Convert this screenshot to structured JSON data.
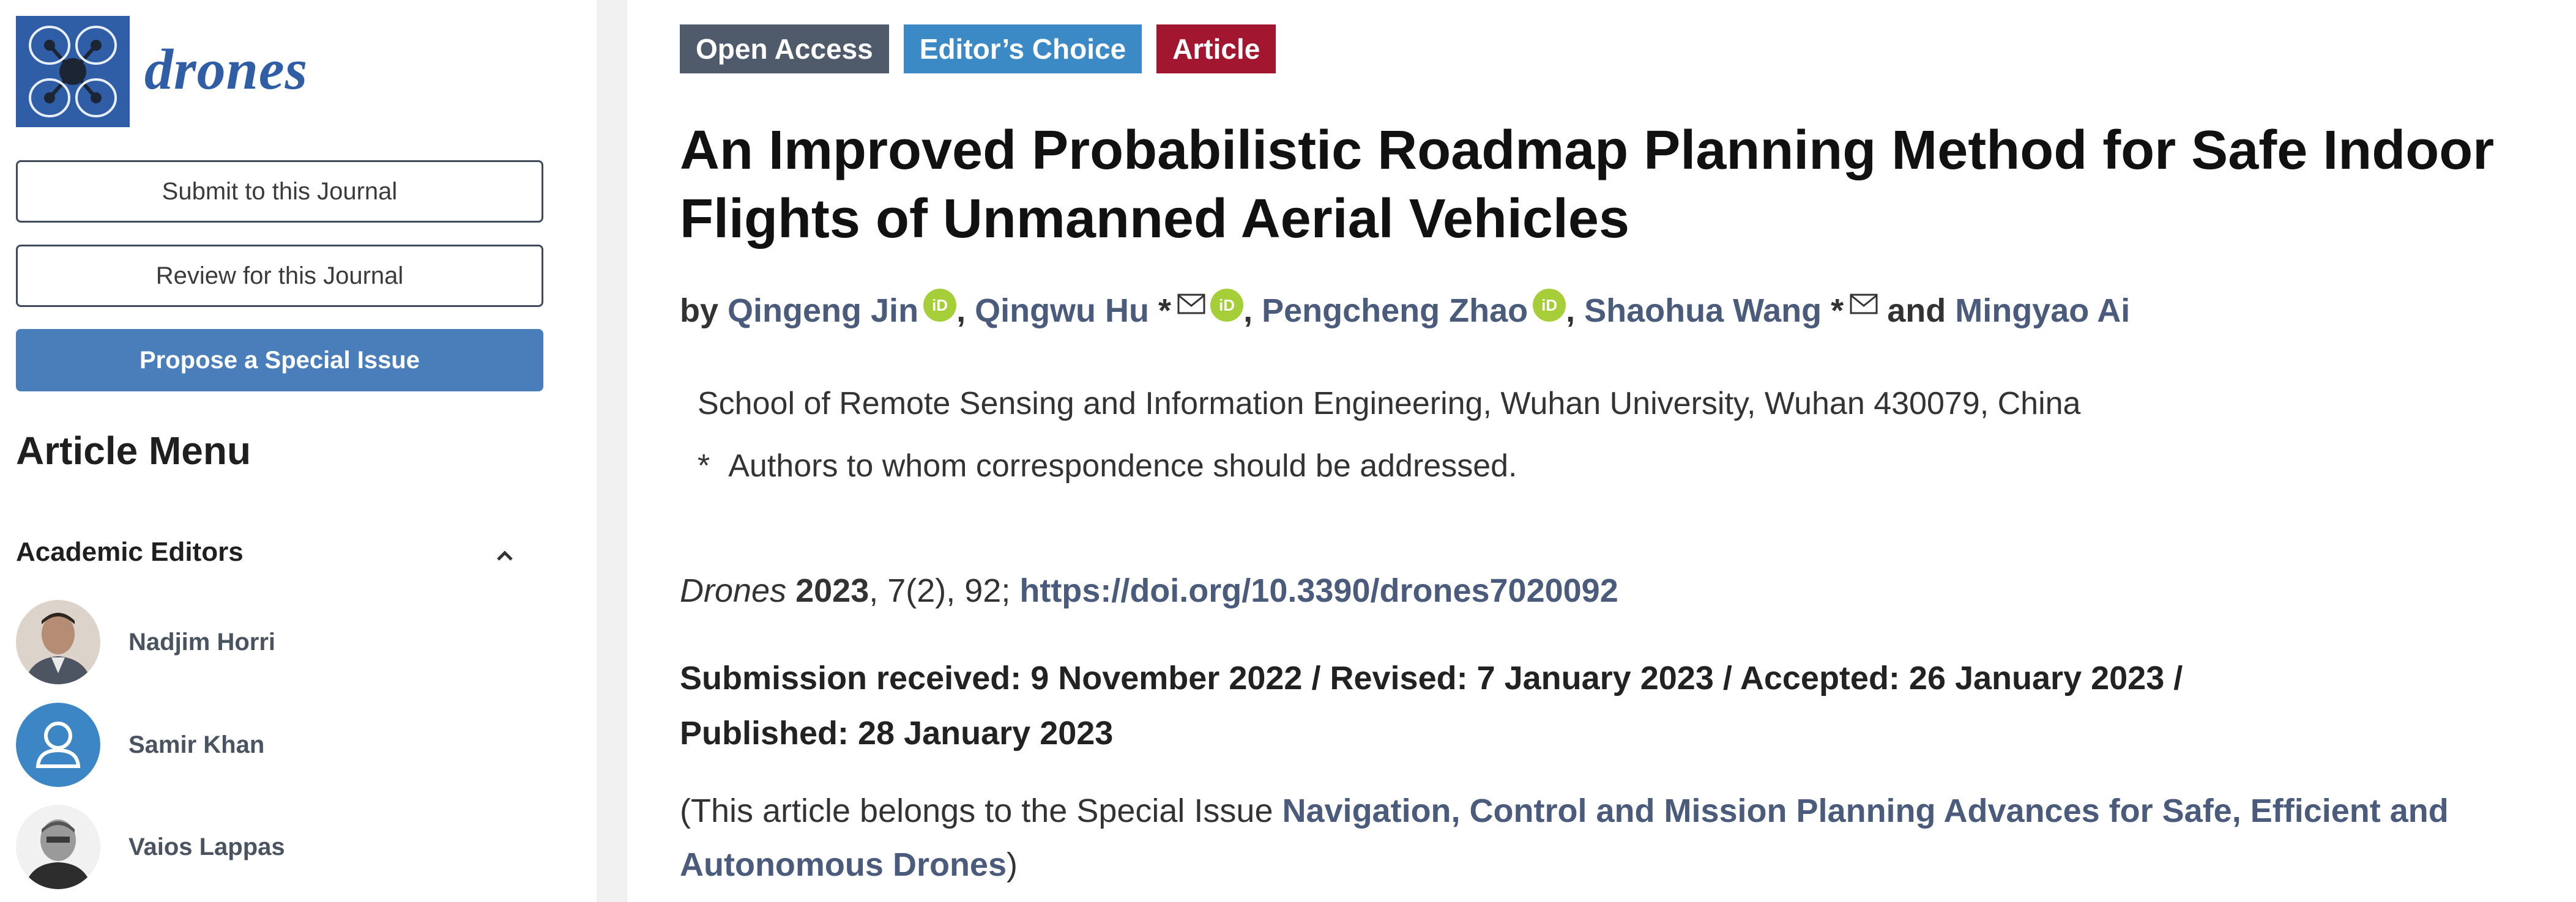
{
  "journal": {
    "logo_text": "drones",
    "brand_color": "#2f5ea6",
    "icon": "drone-logo-icon"
  },
  "sidebar": {
    "buttons": [
      {
        "label": "Submit to this Journal"
      },
      {
        "label": "Review for this Journal"
      },
      {
        "label": "Propose a Special Issue"
      }
    ],
    "menu_heading": "Article Menu",
    "editors_heading": "Academic Editors",
    "editors_icon": "chevron-up-icon",
    "editors": [
      {
        "name": "Nadjim Horri",
        "avatar": "photo"
      },
      {
        "name": "Samir Khan",
        "avatar": "user-placeholder-icon"
      },
      {
        "name": "Vaios Lappas",
        "avatar": "photo"
      }
    ]
  },
  "article": {
    "badges": [
      {
        "label": "Open Access",
        "color": "#4f5b6b"
      },
      {
        "label": "Editor’s Choice",
        "color": "#3b8ac6"
      },
      {
        "label": "Article",
        "color": "#a3162f"
      }
    ],
    "title": "An Improved Probabilistic Roadmap Planning Method for Safe Indoor Flights of Unmanned Aerial Vehicles",
    "by_label": "by",
    "authors": [
      {
        "name": "Qingeng Jin",
        "corresponding": false,
        "orcid": true
      },
      {
        "name": "Qingwu Hu",
        "corresponding": true,
        "orcid": true
      },
      {
        "name": "Pengcheng Zhao",
        "corresponding": false,
        "orcid": true
      },
      {
        "name": "Shaohua Wang",
        "corresponding": true,
        "orcid": false
      },
      {
        "name": "Mingyao Ai",
        "corresponding": false,
        "orcid": false
      }
    ],
    "and_label": "and",
    "star": "*",
    "orcid_label": "iD",
    "affiliation": "School of Remote Sensing and Information Engineering, Wuhan University, Wuhan 430079, China",
    "correspondence_star": "*",
    "correspondence": "Authors to whom correspondence should be addressed.",
    "citation": {
      "journal": "Drones",
      "year": "2023",
      "details": ", 7(2), 92; ",
      "doi": "https://doi.org/10.3390/drones7020092"
    },
    "history_line1": "Submission received: 9 November 2022 / Revised: 7 January 2023 / Accepted: 26 January 2023 /",
    "history_line2": "Published: 28 January 2023",
    "special_issue_prefix": "(This article belongs to the Special Issue ",
    "special_issue_title": "Navigation, Control and Mission Planning Advances for Safe, Efficient and Autonomous Drones",
    "special_issue_suffix": ")"
  }
}
